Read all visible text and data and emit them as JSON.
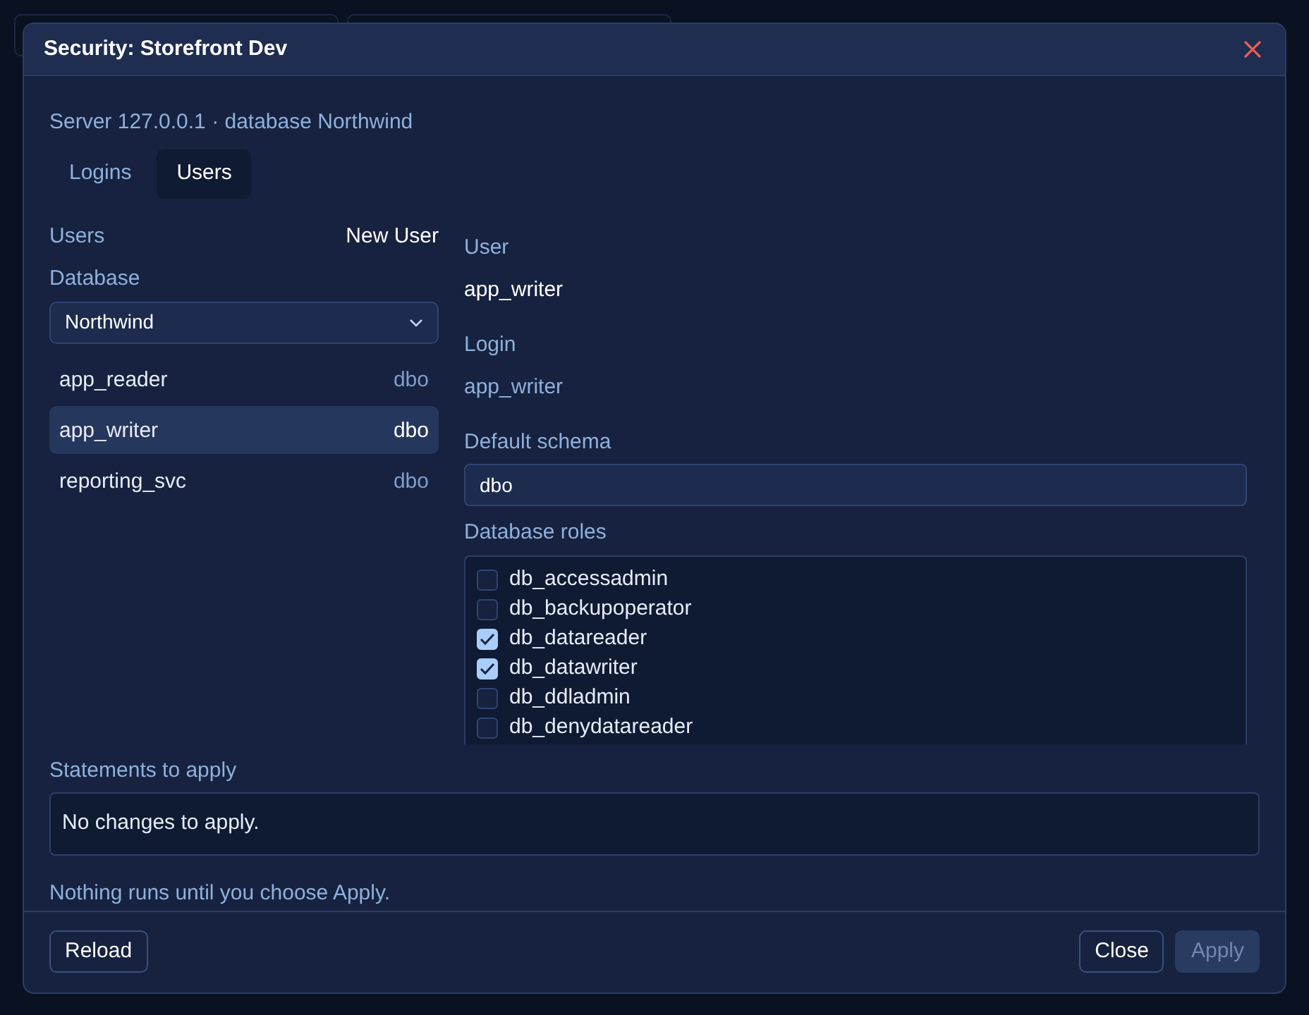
{
  "dialog": {
    "title": "Security: Storefront Dev",
    "subtitle": "Server 127.0.0.1 · database Northwind"
  },
  "tabs": [
    {
      "label": "Logins",
      "selected": false
    },
    {
      "label": "Users",
      "selected": true
    }
  ],
  "users_panel": {
    "heading": "Users",
    "new_button": "New User",
    "database_label": "Database",
    "database_value": "Northwind",
    "users": [
      {
        "name": "app_reader",
        "schema": "dbo",
        "selected": false
      },
      {
        "name": "app_writer",
        "schema": "dbo",
        "selected": true
      },
      {
        "name": "reporting_svc",
        "schema": "dbo",
        "selected": false
      }
    ]
  },
  "details": {
    "user_label": "User",
    "user_value": "app_writer",
    "login_label": "Login",
    "login_value": "app_writer",
    "schema_label": "Default schema",
    "schema_value": "dbo",
    "roles_label": "Database roles",
    "roles": [
      {
        "name": "db_accessadmin",
        "checked": false
      },
      {
        "name": "db_backupoperator",
        "checked": false
      },
      {
        "name": "db_datareader",
        "checked": true
      },
      {
        "name": "db_datawriter",
        "checked": true
      },
      {
        "name": "db_ddladmin",
        "checked": false
      },
      {
        "name": "db_denydatareader",
        "checked": false
      }
    ]
  },
  "statements": {
    "label": "Statements to apply",
    "text": "No changes to apply.",
    "note": "Nothing runs until you choose Apply."
  },
  "footer": {
    "reload": "Reload",
    "close": "Close",
    "apply": "Apply",
    "apply_disabled": true
  }
}
